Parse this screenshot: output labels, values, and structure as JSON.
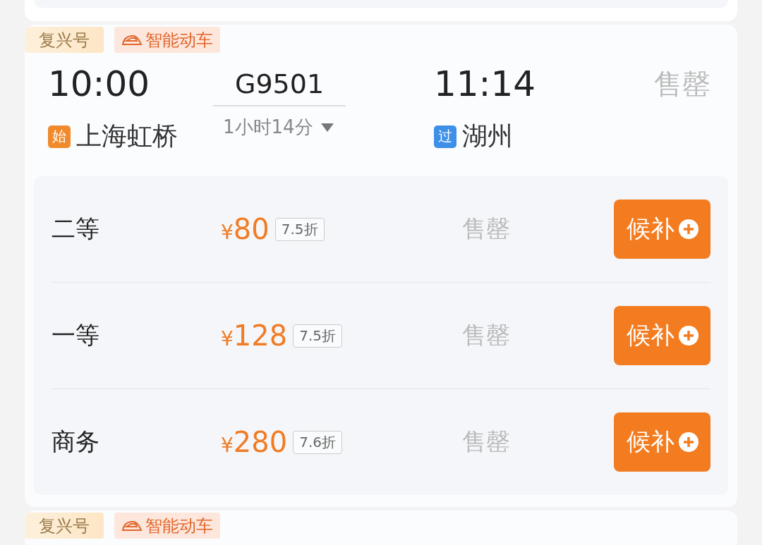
{
  "trains": [
    {
      "tags": [
        {
          "kind": "brand",
          "label": "复兴号"
        },
        {
          "kind": "smart",
          "label": "智能动车"
        }
      ],
      "depart_time": "10:00",
      "train_no": "G9501",
      "duration": "1小时14分",
      "arrive_time": "11:14",
      "status": "售罄",
      "depart_station": {
        "badge": "始",
        "color": "#f08a2c",
        "name": "上海虹桥"
      },
      "arrive_station": {
        "badge": "过",
        "color": "#3d8fe8",
        "name": "湖州"
      },
      "seats": [
        {
          "class": "二等",
          "currency": "¥",
          "amount": "80",
          "discount": "7.5折",
          "status": "售罄",
          "button": "候补"
        },
        {
          "class": "一等",
          "currency": "¥",
          "amount": "128",
          "discount": "7.5折",
          "status": "售罄",
          "button": "候补"
        },
        {
          "class": "商务",
          "currency": "¥",
          "amount": "280",
          "discount": "7.6折",
          "status": "售罄",
          "button": "候补"
        }
      ]
    },
    {
      "tags": [
        {
          "kind": "brand",
          "label": "复兴号"
        },
        {
          "kind": "smart",
          "label": "智能动车"
        }
      ]
    }
  ]
}
